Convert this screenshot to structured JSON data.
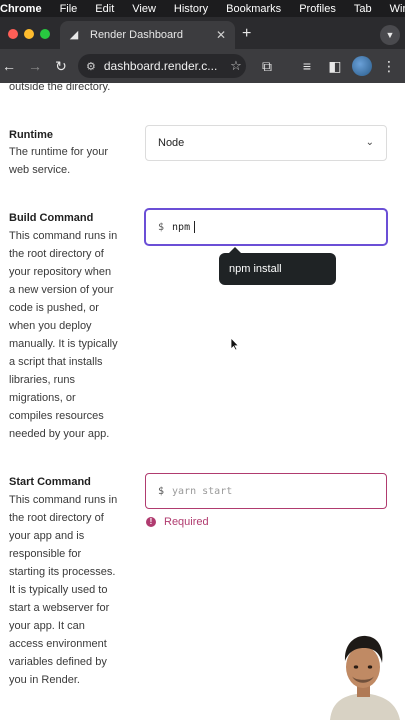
{
  "menubar": {
    "app": "Chrome",
    "items": [
      "File",
      "Edit",
      "View",
      "History",
      "Bookmarks",
      "Profiles",
      "Tab",
      "Wind"
    ]
  },
  "tab": {
    "title": "Render Dashboard"
  },
  "toolbar": {
    "url": "dashboard.render.c..."
  },
  "page": {
    "partial_text": "outside the directory.",
    "runtime": {
      "label": "Runtime",
      "description": "The runtime for your web service.",
      "selected": "Node"
    },
    "build": {
      "label": "Build Command",
      "description": "This command runs in the root directory of your repository when a new version of your code is pushed, or when you deploy manually. It is typically a script that installs libraries, runs migrations, or compiles resources needed by your app.",
      "prompt": "$",
      "value": "npm",
      "suggestion": "npm install"
    },
    "start": {
      "label": "Start Command",
      "description": "This command runs in the root directory of your app and is responsible for starting its processes. It is typically used to start a webserver for your app. It can access environment variables defined by you in Render.",
      "prompt": "$",
      "placeholder": "yarn start",
      "error": "Required"
    }
  },
  "colors": {
    "focus": "#6b4fd6",
    "error": "#b03b6f",
    "tooltip_bg": "#1f2325"
  }
}
